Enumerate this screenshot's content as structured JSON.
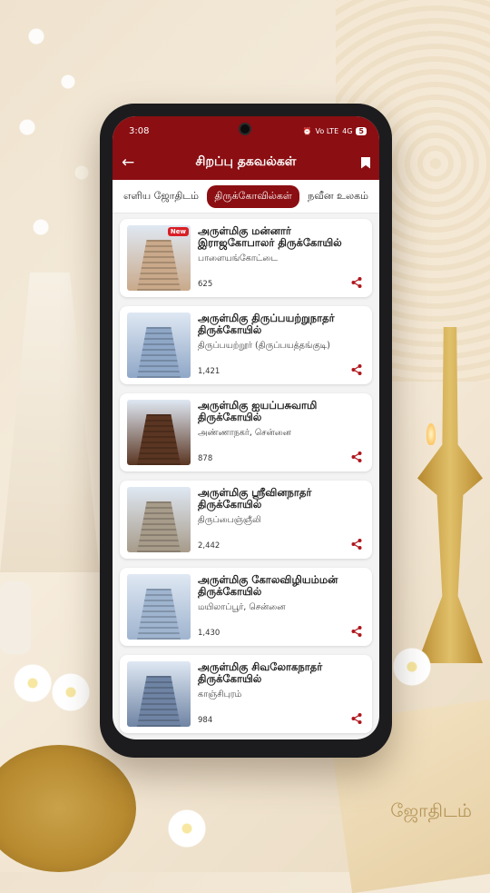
{
  "status": {
    "time": "3:08",
    "net": "Vo LTE",
    "signal": "4G",
    "battery": "5"
  },
  "header": {
    "title": "சிறப்பு தகவல்கள்"
  },
  "tabs": [
    "எளிய ஜோதிடம்",
    "திருக்கோவில்கள்",
    "நவீன உலகம்"
  ],
  "active_tab": 1,
  "new_badge": "New",
  "background": {
    "book_title": "ஜோதிடம்"
  },
  "temples": [
    {
      "title": "அருள்மிகு மன்னார் இராஜகோபாலர் திருக்கோயில்",
      "place": "பாளையங்கோட்டை",
      "views": "625",
      "color": "#c9a98a",
      "new": true
    },
    {
      "title": "அருள்மிகு திருப்பயற்றுநாதர் திருக்கோயில்",
      "place": "திருப்பயற்றூர் (திருப்பயத்தங்குடி)",
      "views": "1,421",
      "color": "#8fa7c7"
    },
    {
      "title": "அருள்மிகு ஐயப்பசுவாமி திருக்கோயில்",
      "place": "அண்ணாநகர், சென்னை",
      "views": "878",
      "color": "#5a3522"
    },
    {
      "title": "அருள்மிகு ஸ்ரீவினநாதர் திருக்கோயில்",
      "place": "திருப்பைஞ்ஞீலி",
      "views": "2,442",
      "color": "#a79b8a"
    },
    {
      "title": "அருள்மிகு கோலவிழியம்மன் திருக்கோயில்",
      "place": "மயிலாப்பூர், சென்னை",
      "views": "1,430",
      "color": "#9fb4cf"
    },
    {
      "title": "அருள்மிகு சிவலோகநாதர் திருக்கோயில்",
      "place": "காஞ்சிபுரம்",
      "views": "984",
      "color": "#6f84a4"
    }
  ]
}
